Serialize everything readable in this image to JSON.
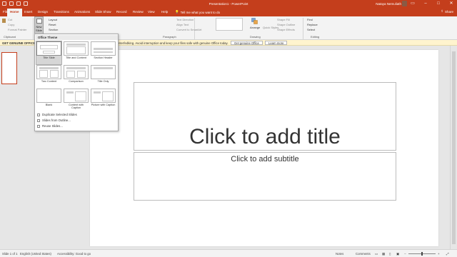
{
  "app": {
    "title": "Presentation1 - PowerPoint",
    "user": "Nataya Nemuliath",
    "accent": "#c43e1c"
  },
  "tabs": [
    "File",
    "Home",
    "Insert",
    "Design",
    "Transitions",
    "Animations",
    "Slide Show",
    "Record",
    "Review",
    "View",
    "Help"
  ],
  "tell_me": "Tell me what you want to do",
  "share": "Share",
  "ribbon": {
    "clipboard": {
      "cut": "Cut",
      "copy": "Copy",
      "format_painter": "Format Painter",
      "label": "Clipboard"
    },
    "slides": {
      "new_slide": "New Slide",
      "layout": "Layout",
      "reset": "Reset",
      "section": "Section"
    },
    "paragraph_label": "Paragraph",
    "drawing": {
      "text_direction": "Text Direction",
      "align_text": "Align Text",
      "smartart": "Convert to SmartArt",
      "arrange": "Arrange",
      "quick_styles": "Quick Styles",
      "shape_fill": "Shape Fill",
      "shape_outline": "Shape Outline",
      "shape_effects": "Shape Effects",
      "label": "Drawing"
    },
    "editing": {
      "find": "Find",
      "replace": "Replace",
      "select": "Select",
      "label": "Editing"
    }
  },
  "notification": {
    "lead": "GET GENUINE OFFICE",
    "message": "interfedking. Avoid interruption and keep your files safe with genuine Office today.",
    "get_btn": "Get genuine Office",
    "learn_btn": "Learn more"
  },
  "dropdown": {
    "header": "Office Theme",
    "layouts": [
      {
        "name": "Title Slide",
        "selected": true
      },
      {
        "name": "Title and Content",
        "selected": false
      },
      {
        "name": "Section Header",
        "selected": false
      },
      {
        "name": "Two Content",
        "selected": false
      },
      {
        "name": "Comparison",
        "selected": false
      },
      {
        "name": "Title Only",
        "selected": false
      },
      {
        "name": "Blank",
        "selected": false
      },
      {
        "name": "Content with Caption",
        "selected": false
      },
      {
        "name": "Picture with Caption",
        "selected": false
      }
    ],
    "commands": [
      "Duplicate Selected Slides",
      "Slides from Outline...",
      "Reuse Slides..."
    ]
  },
  "thumbnail": {
    "number": "1"
  },
  "slide": {
    "title_placeholder": "Click to add title",
    "subtitle_placeholder": "Click to add subtitle"
  },
  "status": {
    "slide_count": "Slide 1 of 1",
    "language": "English (United States)",
    "accessibility": "Accessibility: Good to go",
    "notes": "Notes",
    "comments": "Comments"
  }
}
